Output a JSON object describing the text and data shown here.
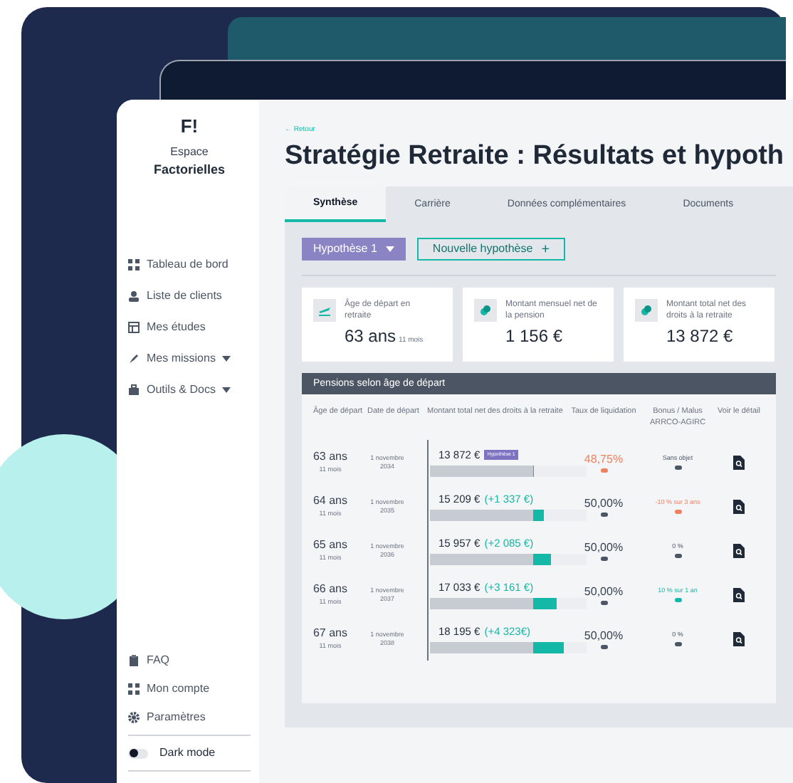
{
  "sidebar": {
    "logo": "F!",
    "space_label": "Espace",
    "space_name": "Factorielles",
    "items": [
      {
        "label": "Tableau de bord",
        "has_menu": false
      },
      {
        "label": "Liste de clients",
        "has_menu": false
      },
      {
        "label": "Mes études",
        "has_menu": false
      },
      {
        "label": "Mes missions",
        "has_menu": true
      },
      {
        "label": "Outils & Docs",
        "has_menu": true
      }
    ],
    "bottom_items": [
      {
        "label": "FAQ"
      },
      {
        "label": "Mon compte"
      },
      {
        "label": "Paramètres"
      }
    ],
    "dark_mode": {
      "label": "Dark mode",
      "on": false
    }
  },
  "back_link": "← Retour",
  "title": "Stratégie Retraite : Résultats et hypoth",
  "tabs": [
    {
      "label": "Synthèse",
      "selected": true
    },
    {
      "label": "Carrière",
      "selected": false
    },
    {
      "label": "Données complémentaires",
      "selected": false
    },
    {
      "label": "Documents",
      "selected": false
    }
  ],
  "hypothesis_button": "Hypothèse 1",
  "new_hypothesis_button": "Nouvelle hypothèse",
  "new_hypothesis_icon": "+",
  "cards": [
    {
      "label": "Âge de départ en retraite",
      "value": "63 ans",
      "unit": "11 mois"
    },
    {
      "label": "Montant mensuel net de la pension",
      "value": "1 156 €"
    },
    {
      "label": "Montant total net des droits à la retraite",
      "value": "13 872 €"
    }
  ],
  "table": {
    "title": "Pensions selon âge de départ",
    "columns": [
      "Âge de départ",
      "Date de départ",
      "Montant total net des droits à la retraite",
      "Taux de liquidation",
      "Bonus / Malus ARRCO-AGIRC",
      "Voir le détail"
    ],
    "rows": [
      {
        "age": "63 ans",
        "months": "11 mois",
        "date": "1 novembre 2034",
        "amount": "13 872 €",
        "gain": "",
        "badge": "Hypothèse 1",
        "level": 0.66,
        "rate": "48,75%",
        "rate_warning": true,
        "bonus": "Sans objet",
        "color": "#4b5563"
      },
      {
        "age": "64 ans",
        "months": "11 mois",
        "date": "1 novembre 2035",
        "amount": "15 209 €",
        "gain": "(+1 337 €)",
        "level": 0.73,
        "rate": "50,00%",
        "rate_warning": false,
        "bonus": "-10 % sur 3 ans",
        "color": "#f0805f"
      },
      {
        "age": "65 ans",
        "months": "11 mois",
        "date": "1 novembre 2036",
        "amount": "15 957 €",
        "gain": "(+2 085 €)",
        "level": 0.77,
        "rate": "50,00%",
        "rate_warning": false,
        "bonus": "0 %",
        "color": "#4b5563"
      },
      {
        "age": "66 ans",
        "months": "11 mois",
        "date": "1 novembre 2037",
        "amount": "17 033 €",
        "gain": "(+3 161 €)",
        "level": 0.81,
        "rate": "50,00%",
        "rate_warning": false,
        "bonus": "10 % sur 1 an",
        "color": "#14b8a6"
      },
      {
        "age": "67 ans",
        "months": "11 mois",
        "date": "1 novembre 2038",
        "amount": "18 195 €",
        "gain": "(+4 323€)",
        "level": 0.85,
        "rate": "50,00%",
        "rate_warning": false,
        "bonus": "0 %",
        "color": "#4b5563"
      }
    ]
  }
}
